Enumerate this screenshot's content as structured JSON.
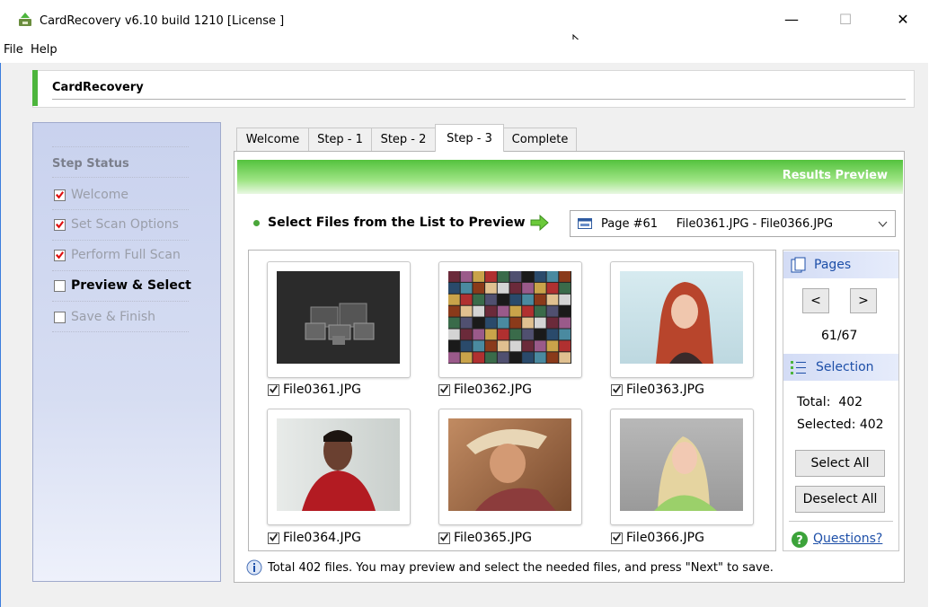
{
  "window": {
    "title": "CardRecovery v6.10 build 1210  [License ]",
    "minimize": "—",
    "maximize": "☐",
    "close": "✕"
  },
  "menu": [
    "File",
    "Help"
  ],
  "header": {
    "title": "CardRecovery"
  },
  "sidebar": {
    "heading": "Step Status",
    "steps": [
      {
        "label": "Welcome",
        "checked": true
      },
      {
        "label": "Set Scan Options",
        "checked": true
      },
      {
        "label": "Perform Full Scan",
        "checked": true
      },
      {
        "label": "Preview & Select",
        "checked": false
      },
      {
        "label": "Save & Finish",
        "checked": false
      }
    ]
  },
  "tabs": [
    "Welcome",
    "Step - 1",
    "Step - 2",
    "Step - 3",
    "Complete"
  ],
  "results": {
    "title": "Results Preview",
    "select_label": "Select Files from the List to Preview",
    "page_select_value": "Page #61     File0361.JPG - File0366.JPG"
  },
  "files": [
    {
      "name": "File0361.JPG",
      "checked": true
    },
    {
      "name": "File0362.JPG",
      "checked": true
    },
    {
      "name": "File0363.JPG",
      "checked": true
    },
    {
      "name": "File0364.JPG",
      "checked": true
    },
    {
      "name": "File0365.JPG",
      "checked": true
    },
    {
      "name": "File0366.JPG",
      "checked": true
    }
  ],
  "pages_panel": {
    "title": "Pages",
    "prev": "<",
    "next": ">",
    "counter": "61/67"
  },
  "selection_panel": {
    "title": "Selection",
    "total": "Total:  402",
    "selected": "Selected: 402",
    "select_all": "Select All",
    "deselect_all": "Deselect All"
  },
  "help": {
    "link": "Questions?"
  },
  "status": {
    "text": "Total 402 files.  You may preview and select the needed files, and press \"Next\" to save."
  },
  "colors": {
    "accent_green": "#4db53d",
    "link_blue": "#1d4fa8",
    "sidebar_blue": "#c9d2ee"
  }
}
